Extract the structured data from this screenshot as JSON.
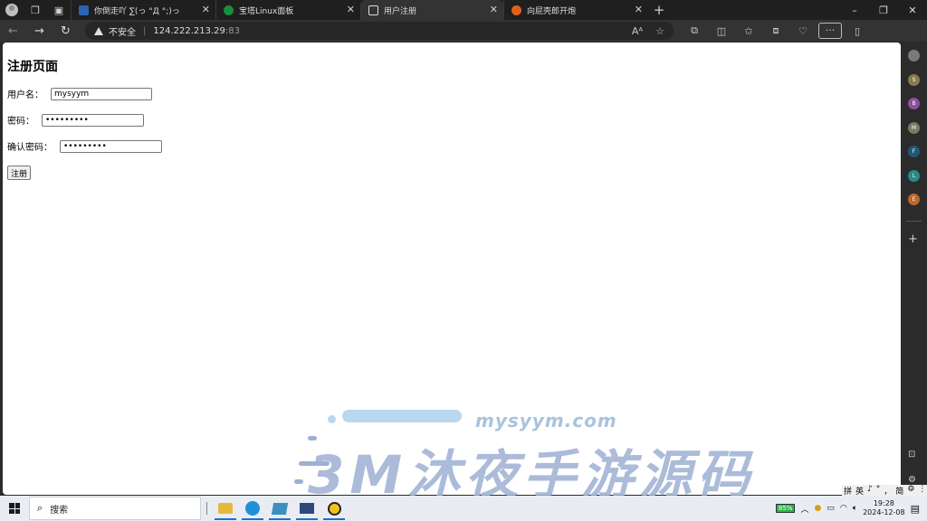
{
  "browser": {
    "tabs": [
      {
        "title": "你倒走吖 ∑(っ °Д °;)っ",
        "favicon_color": "#2a63b4",
        "active": false
      },
      {
        "title": "宝塔Linux面板",
        "favicon_color": "#1a8f3c",
        "active": false
      },
      {
        "title": "用户注册",
        "favicon_color": "#dddddd",
        "active": true
      },
      {
        "title": "向屁壳郎开炮",
        "favicon_color": "#e0611c",
        "active": false
      }
    ],
    "new_tab_glyph": "+",
    "security_label": "不安全",
    "url_host": "124.222.213.29",
    "url_port": ":83",
    "window_controls": [
      "–",
      "❐",
      "✕"
    ]
  },
  "page": {
    "heading": "注册页面",
    "username_label": "用户名：",
    "username_value": "mysyym",
    "password_label": "密码：",
    "password_value": "•••••••••",
    "confirm_label": "确认密码：",
    "confirm_value": "•••••••••",
    "submit_label": "注册"
  },
  "watermark": {
    "site": "mysyym.com",
    "brand": "3M沐夜手游源码"
  },
  "sidebar": {
    "items": [
      {
        "letter": "",
        "color": "#7a7a7a"
      },
      {
        "letter": "S",
        "color": "#8a7a52"
      },
      {
        "letter": "B",
        "color": "#8e4fa0"
      },
      {
        "letter": "M",
        "color": "#7a7a60"
      },
      {
        "letter": "F",
        "color": "#1f5a78"
      },
      {
        "letter": "L",
        "color": "#2a8a8a"
      },
      {
        "letter": "E",
        "color": "#c0662a"
      }
    ]
  },
  "taskbar": {
    "search_label": "搜索",
    "battery": "85%",
    "time": "19:28",
    "date": "2024-12-08",
    "ime": [
      "拼",
      "英",
      "♪",
      "°",
      "，",
      "简",
      "⚙",
      "⋮"
    ]
  }
}
